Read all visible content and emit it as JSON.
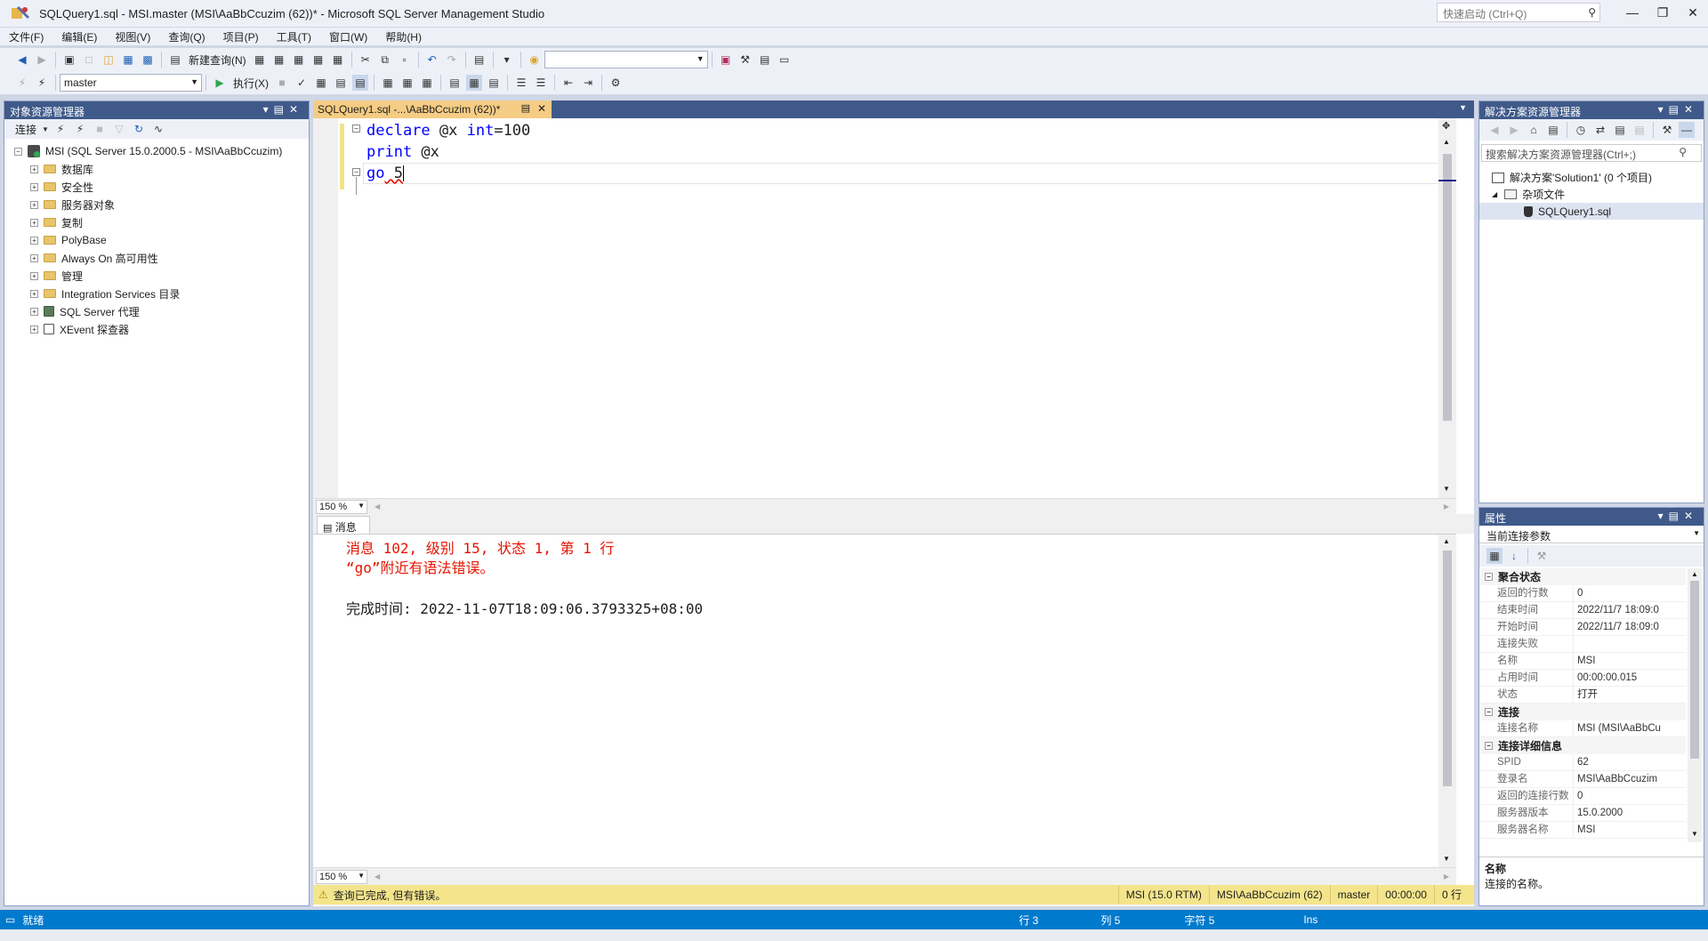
{
  "window": {
    "title": "SQLQuery1.sql - MSI.master (MSI\\AaBbCcuzim (62))* - Microsoft SQL Server Management Studio",
    "quick_launch_placeholder": "快速启动 (Ctrl+Q)"
  },
  "menu": [
    "文件(F)",
    "编辑(E)",
    "视图(V)",
    "查询(Q)",
    "项目(P)",
    "工具(T)",
    "窗口(W)",
    "帮助(H)"
  ],
  "toolbar": {
    "new_query": "新建查询(N)",
    "database": "master",
    "execute": "执行(X)"
  },
  "object_explorer": {
    "title": "对象资源管理器",
    "connect_label": "连接",
    "server": "MSI (SQL Server 15.0.2000.5 - MSI\\AaBbCcuzim)",
    "nodes": [
      "数据库",
      "安全性",
      "服务器对象",
      "复制",
      "PolyBase",
      "Always On 高可用性",
      "管理",
      "Integration Services 目录",
      "SQL Server 代理",
      "XEvent 探查器"
    ]
  },
  "editor": {
    "tab": "SQLQuery1.sql -...\\AaBbCcuzim (62))*",
    "code": {
      "l1_kw1": "declare",
      "l1_var": " @x ",
      "l1_kw2": "int",
      "l1_rest": "=100",
      "l2_kw": "print",
      "l2_rest": " @x",
      "l3_kw": "go",
      "l3_rest": " 5"
    },
    "zoom": "150 %"
  },
  "messages": {
    "tab": "消息",
    "error_line1": "消息 102, 级别 15, 状态 1, 第 1 行",
    "error_line2": "“go”附近有语法错误。",
    "completion": "完成时间: 2022-11-07T18:09:06.3793325+08:00",
    "zoom": "150 %"
  },
  "query_status": {
    "message": "查询已完成, 但有错误。",
    "server": "MSI (15.0 RTM)",
    "user": "MSI\\AaBbCcuzim (62)",
    "db": "master",
    "time": "00:00:00",
    "rows": "0 行"
  },
  "solution_explorer": {
    "title": "解决方案资源管理器",
    "search_placeholder": "搜索解决方案资源管理器(Ctrl+;)",
    "solution": "解决方案'Solution1' (0 个项目)",
    "misc": "杂项文件",
    "file": "SQLQuery1.sql"
  },
  "properties": {
    "title": "属性",
    "selector": "当前连接参数",
    "cat1": "聚合状态",
    "cat2": "连接",
    "cat3": "连接详细信息",
    "rows1": [
      [
        "返回的行数",
        "0"
      ],
      [
        "结束时间",
        "2022/11/7 18:09:0"
      ],
      [
        "开始时间",
        "2022/11/7 18:09:0"
      ],
      [
        "连接失败",
        ""
      ],
      [
        "名称",
        "MSI"
      ],
      [
        "占用时间",
        "00:00:00.015"
      ],
      [
        "状态",
        "打开"
      ]
    ],
    "rows2": [
      [
        "连接名称",
        "MSI (MSI\\AaBbCu"
      ]
    ],
    "rows3": [
      [
        "SPID",
        "62"
      ],
      [
        "登录名",
        "MSI\\AaBbCcuzim"
      ],
      [
        "返回的连接行数",
        "0"
      ],
      [
        "服务器版本",
        "15.0.2000"
      ],
      [
        "服务器名称",
        "MSI"
      ]
    ],
    "desc_title": "名称",
    "desc_text": "连接的名称。"
  },
  "statusbar": {
    "ready": "就绪",
    "row": "行 3",
    "col": "列 5",
    "char": "字符 5",
    "mode": "Ins"
  },
  "colors": {
    "accent": "#007acc",
    "panel_title": "#3f5a8a",
    "active_tab": "#f5cc84",
    "error_text": "#e51400",
    "keyword": "#0000ff",
    "query_status_bg": "#f4e58c"
  }
}
